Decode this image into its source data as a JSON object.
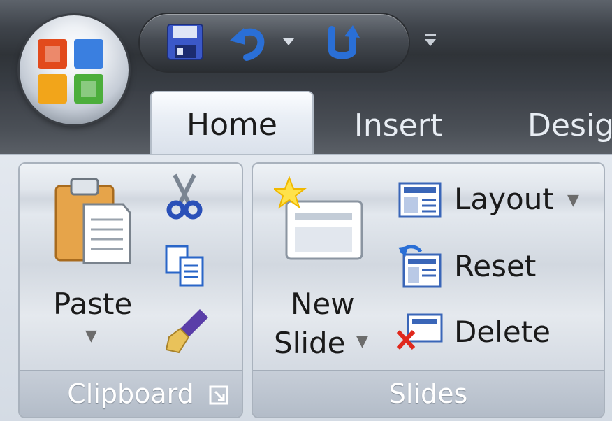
{
  "app": {
    "name": "PowerPoint 2007 ribbon",
    "office_button": {
      "icon": "office-logo-icon"
    }
  },
  "quick_access": {
    "items": [
      {
        "name": "save",
        "icon": "floppy-disk-icon"
      },
      {
        "name": "undo",
        "icon": "undo-arrow-icon"
      },
      {
        "name": "undo-dropdown",
        "icon": "chevron-down-icon"
      },
      {
        "name": "redo",
        "icon": "redo-arrow-icon"
      },
      {
        "name": "customize",
        "icon": "customize-dropdown-icon"
      }
    ]
  },
  "tabs": [
    {
      "label": "Home",
      "active": true
    },
    {
      "label": "Insert",
      "active": false
    },
    {
      "label": "Desig",
      "active": false
    }
  ],
  "groups": {
    "clipboard": {
      "title": "Clipboard",
      "paste_label": "Paste",
      "buttons": [
        {
          "name": "cut",
          "icon": "scissors-icon"
        },
        {
          "name": "copy",
          "icon": "copy-icon"
        },
        {
          "name": "format-painter",
          "icon": "paintbrush-icon"
        }
      ],
      "launcher_icon": "dialog-launcher-icon"
    },
    "slides": {
      "title": "Slides",
      "new_slide_line1": "New",
      "new_slide_line2": "Slide",
      "layout_label": "Layout",
      "reset_label": "Reset",
      "delete_label": "Delete"
    }
  },
  "colors": {
    "title_bar": "#3f444b",
    "ribbon": "#d4dbe4",
    "group_label_bg": "#b3bcc8",
    "accent_blue": "#2a6fd6"
  }
}
